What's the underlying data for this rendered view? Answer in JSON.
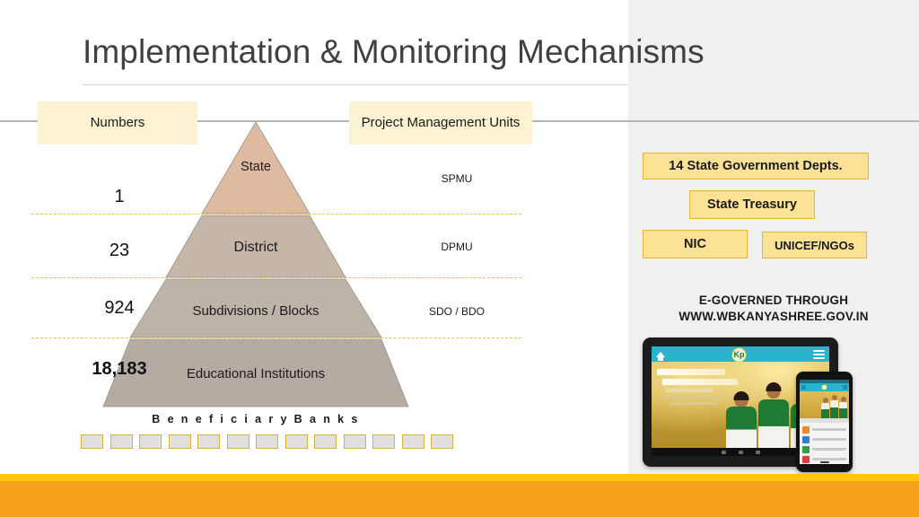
{
  "slide": {
    "title": "Implementation & Monitoring Mechanisms"
  },
  "headers": {
    "numbers_label": "Numbers",
    "pmu_label": "Project Management Units"
  },
  "pyramid": {
    "levels": [
      {
        "name": "State",
        "number": "1",
        "pmu": "SPMU"
      },
      {
        "name": "District",
        "number": "23",
        "pmu": "DPMU"
      },
      {
        "name": "Subdivisions / Blocks",
        "number": "924",
        "pmu": "SDO / BDO"
      },
      {
        "name": "Educational Institutions",
        "number": "18,183",
        "pmu": ""
      }
    ],
    "colors": {
      "level1": "#ddbaa0",
      "level2": "#c6b6a8",
      "level3": "#bdb4a9",
      "level4": "#b4aca3",
      "divider": "#e8c43c"
    }
  },
  "banks": {
    "label": "B e n e f i c i a r y   B a n k s",
    "count": 13,
    "box_fill": "#e2e0dc",
    "box_border": "#d9b43c"
  },
  "partners": {
    "boxes": [
      {
        "label": "14 State Government Depts."
      },
      {
        "label": "State Treasury"
      },
      {
        "label": "NIC"
      },
      {
        "label": "UNICEF/NGOs"
      }
    ],
    "box_fill": "#fbe294",
    "box_border": "#e7b52e"
  },
  "egovernance": {
    "line1": "E-GOVERNED THROUGH",
    "line2": "WWW.WBKANYASHREE.GOV.IN"
  },
  "device_mockup": {
    "app_logo_text": "Kp",
    "header_color": "#2ab4cc",
    "banner_color": "#caa132"
  },
  "footer": {
    "accent_yellow": "#ffc40d",
    "accent_orange": "#f7a01b"
  }
}
